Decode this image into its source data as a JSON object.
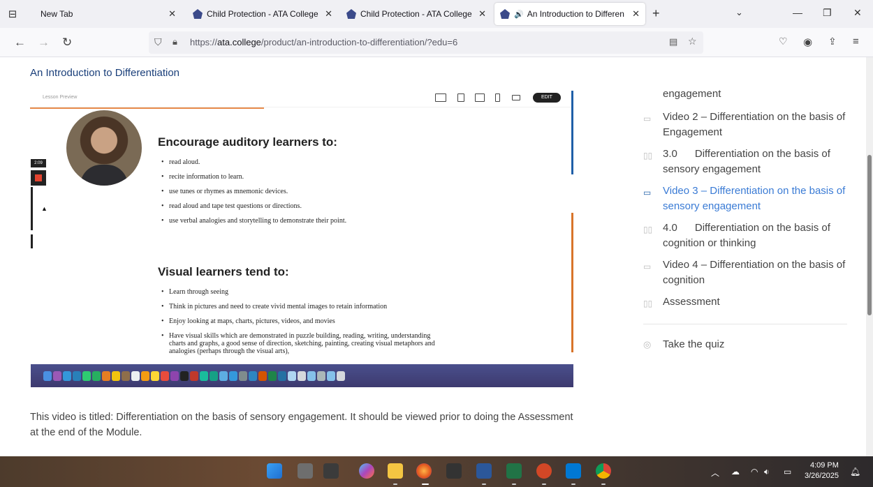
{
  "browser": {
    "tabs": [
      {
        "title": "New Tab",
        "active": false
      },
      {
        "title": "Child Protection - ATA College",
        "active": false
      },
      {
        "title": "Child Protection - ATA College",
        "active": false
      },
      {
        "title": "An Introduction to Differen",
        "active": true,
        "audio": true
      }
    ],
    "url_prefix": "https://",
    "url_domain": "ata.college",
    "url_path": "/product/an-introduction-to-differentiation/?edu=6"
  },
  "page": {
    "title": "An Introduction to Differentiation",
    "video": {
      "lesson_preview": "Lesson Preview",
      "edit_label": "EDIT",
      "timer": "2:09",
      "heading_auditory": "Encourage auditory learners to:",
      "auditory_items": [
        "read aloud.",
        "recite information to learn.",
        "use tunes or rhymes as mnemonic devices.",
        "read aloud and tape test questions or directions.",
        "use verbal analogies and storytelling to demonstrate their point."
      ],
      "heading_visual": "Visual learners tend to:",
      "visual_items": [
        "Learn through seeing",
        "Think in pictures and need to create vivid mental images to retain information",
        "Enjoy looking at maps, charts, pictures, videos, and movies",
        "Have visual skills which are demonstrated in puzzle building, reading, writing, understanding charts and graphs, a good sense of direction, sketching, painting, creating visual metaphors and analogies (perhaps through the visual arts),"
      ]
    },
    "caption": "This video is titled: Differentiation on the basis of sensory engagement. It should be viewed prior to doing the Assessment at the end of the Module."
  },
  "sidebar": {
    "fragment": "engagement",
    "items": [
      {
        "label": "Video 2 – Differentiation on the basis of Engagement",
        "type": "video",
        "current": false
      },
      {
        "label": "3.0      Differentiation on the basis of sensory engagement",
        "type": "lesson",
        "current": false
      },
      {
        "label": "Video 3 – Differentiation on the basis of sensory engagement",
        "type": "video",
        "current": true
      },
      {
        "label": "4.0      Differentiation on the basis of cognition or thinking",
        "type": "lesson",
        "current": false
      },
      {
        "label": "Video 4 – Differentiation on the basis of cognition",
        "type": "video",
        "current": false
      },
      {
        "label": "Assessment",
        "type": "lesson",
        "current": false
      }
    ],
    "quiz": "Take the quiz"
  },
  "taskbar": {
    "time": "4:09 PM",
    "date": "3/26/2025"
  },
  "colors": {
    "link_blue": "#1a3f7a",
    "current_item": "#3a7bd5",
    "accent_orange": "#e88b4b"
  }
}
